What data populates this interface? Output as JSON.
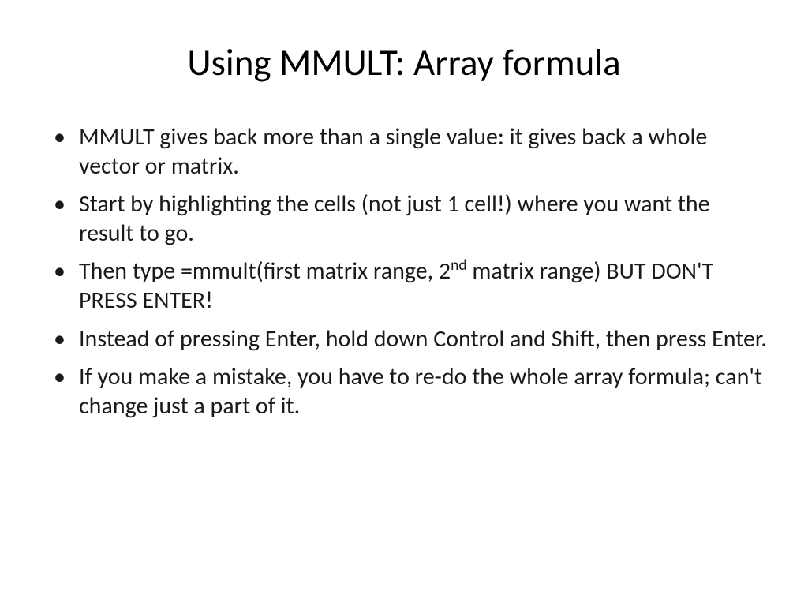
{
  "slide": {
    "title": "Using MMULT: Array formula",
    "bullets": [
      {
        "text": "MMULT gives back more than a single value: it gives back a whole vector or matrix."
      },
      {
        "text": "Start by highlighting the cells (not just 1 cell!) where you want the result to go."
      },
      {
        "prefix": "Then type =mmult(first matrix range, 2",
        "super": "nd",
        "suffix": " matrix range) BUT DON'T PRESS ENTER!"
      },
      {
        "text": "Instead of pressing Enter, hold down Control and Shift, then press Enter."
      },
      {
        "text": "If you make a mistake, you have to re-do the whole array formula; can't change just a part of it."
      }
    ]
  }
}
